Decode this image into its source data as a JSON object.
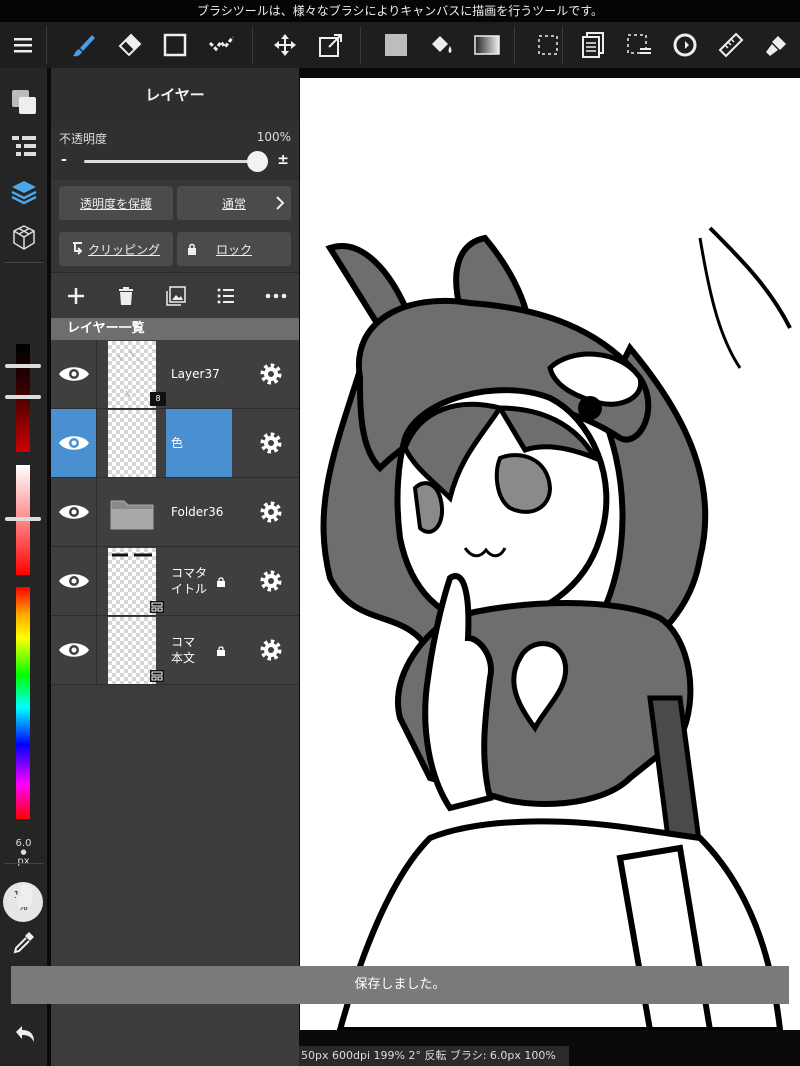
{
  "hint": "ブラシツールは、様々なブラシによりキャンバスに描画を行うツールです。",
  "toolbar": {
    "tools": [
      "menu-icon",
      "brush-icon",
      "eraser-icon",
      "rectangle-icon",
      "stroke-select-icon",
      "move-icon",
      "transform-icon",
      "fill-color-icon",
      "bucket-icon",
      "gradient-icon",
      "selection-icon",
      "copy-icon",
      "deselect-icon",
      "rotate-icon",
      "ruler-icon",
      "filter-icon"
    ],
    "active_tool": "brush-icon"
  },
  "layer_panel": {
    "title": "レイヤー",
    "opacity_label": "不透明度",
    "opacity_value": "100%",
    "opacity_level": 1.0,
    "minus": "-",
    "plus": "±",
    "protect_alpha": "透明度を保護",
    "blend_mode": "通常",
    "clipping": "クリッピング",
    "lock": "ロック",
    "list_header": "レイヤー一覧",
    "layers": [
      {
        "name": "Layer37",
        "badge": "8"
      },
      {
        "name": "色",
        "selected": true
      },
      {
        "name": "Folder36"
      },
      {
        "name": "コマタイトル",
        "locked": true
      },
      {
        "name": "コマ本文",
        "locked": true
      }
    ]
  },
  "left_rail": {
    "brush_size": "6.0",
    "brush_unit": "px",
    "brush_opacity": "100",
    "brush_opacity_unit": "%"
  },
  "toast": "保存しました。",
  "status": "50px 600dpi 199% 2° 反転 ブラシ: 6.0px 100%",
  "colors": {
    "accent": "#4a8fd0",
    "panel": "#3c3c3c",
    "toolbar": "#1e1e1e"
  }
}
